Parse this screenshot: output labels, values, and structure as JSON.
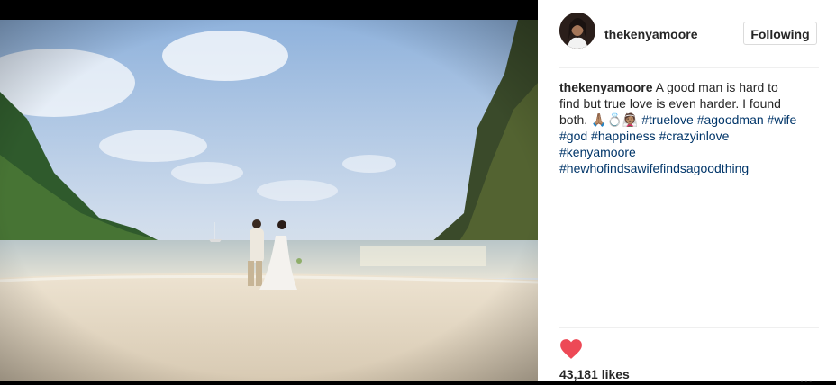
{
  "post": {
    "username": "thekenyamoore",
    "follow_label": "Following",
    "caption": {
      "username": "thekenyamoore",
      "text": "A good man is hard to find but true love is even harder. I found both.",
      "emoji": "🙏🏽💍👰🏽",
      "hashtags": [
        "#truelove",
        "#agoodman",
        "#wife",
        "#god",
        "#happiness",
        "#crazyinlove",
        "#kenyamoore",
        "#hewhofindsawifefindsagoodthing"
      ]
    },
    "likes": "43,181 likes",
    "more_label": "...",
    "heart_color": "#ed4956"
  }
}
